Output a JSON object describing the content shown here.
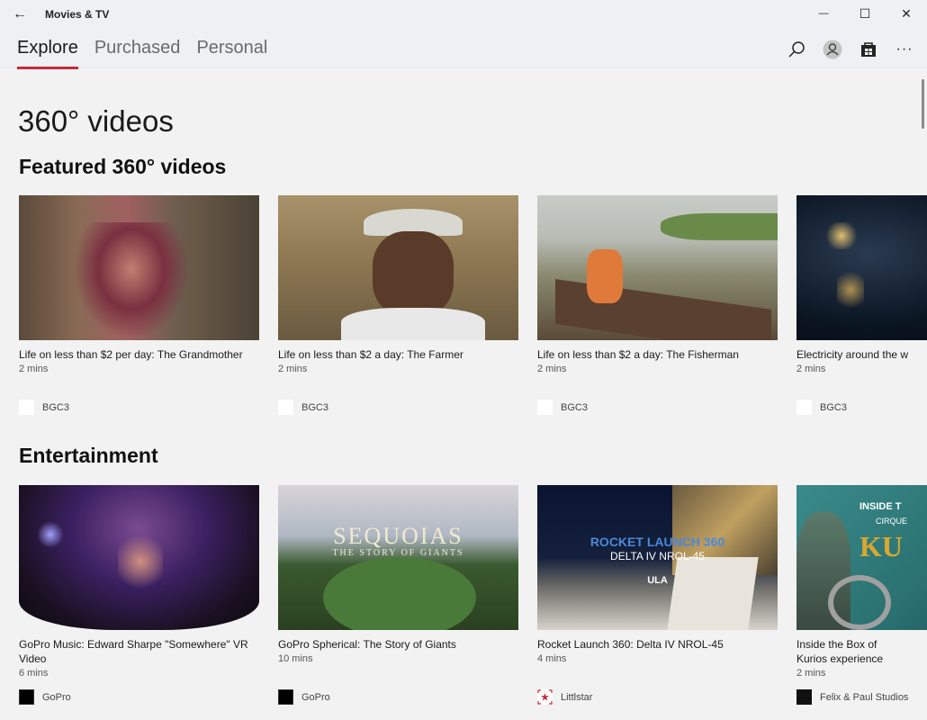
{
  "window": {
    "back_label": "←",
    "title": "Movies & TV",
    "minimize_label": "—",
    "maximize_label": "☐",
    "close_label": "✕"
  },
  "tabs": [
    {
      "label": "Explore",
      "active": true
    },
    {
      "label": "Purchased",
      "active": false
    },
    {
      "label": "Personal",
      "active": false
    }
  ],
  "toolbar": {
    "search_icon": "search-icon",
    "account_icon": "account-icon",
    "store_icon": "store-icon",
    "more_label": "···"
  },
  "page": {
    "title": "360° videos"
  },
  "sections": [
    {
      "title": "Featured 360° videos",
      "items": [
        {
          "title": "Life on less than $2 per day: The Grandmother",
          "duration": "2 mins",
          "provider": "BGC3"
        },
        {
          "title": "Life on less than $2 a day: The Farmer",
          "duration": "2 mins",
          "provider": "BGC3"
        },
        {
          "title": "Life on less than $2 a day: The Fisherman",
          "duration": "2 mins",
          "provider": "BGC3"
        },
        {
          "title": "Electricity around the w",
          "duration": "2 mins",
          "provider": "BGC3"
        }
      ]
    },
    {
      "title": "Entertainment",
      "items": [
        {
          "title": "GoPro Music: Edward Sharpe \"Somewhere\" VR Video",
          "duration": "6 mins",
          "provider": "GoPro"
        },
        {
          "title": "GoPro Spherical: The Story of Giants",
          "duration": "10 mins",
          "provider": "GoPro",
          "thumb_text": "SEQUOIAS",
          "thumb_subtext": "THE STORY OF GIANTS"
        },
        {
          "title": "Rocket Launch 360: Delta IV NROL-45",
          "duration": "4 mins",
          "provider": "Littlstar",
          "thumb_text": "ROCKET LAUNCH 360",
          "thumb_subtext": "DELTA IV NROL-45",
          "thumb_logo": "ULA"
        },
        {
          "title": "Inside the Box of Kurios experience coming soo",
          "duration": "2 mins",
          "provider": "Felix & Paul Studios",
          "thumb_text": "INSIDE T",
          "thumb_subtext": "CIRQUE",
          "thumb_logo": "KU"
        }
      ]
    }
  ],
  "colors": {
    "accent": "#c62b39",
    "background": "#f2f2f2",
    "titlebar": "#eef0f4"
  }
}
